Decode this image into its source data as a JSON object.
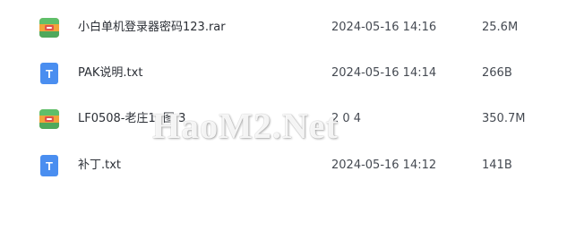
{
  "files": [
    {
      "name": "小白单机登录器密码123.rar",
      "date": "2024-05-16 14:16",
      "size": "25.6M",
      "icon": "archive-icon"
    },
    {
      "name": "PAK说明.txt",
      "date": "2024-05-16 14:14",
      "size": "266B",
      "icon": "text-file-icon",
      "icon_letter": "T"
    },
    {
      "name": "LF0508-老庄1.    图    3",
      "date": "2    0        4",
      "size": "350.7M",
      "icon": "archive-icon"
    },
    {
      "name": "补丁.txt",
      "date": "2024-05-16 14:12",
      "size": "141B",
      "icon": "text-file-icon",
      "icon_letter": "T"
    }
  ],
  "watermark": {
    "text": "HaoM2.Net"
  },
  "colors": {
    "text_file_icon": "#4a8ef0",
    "archive_orange": "#f2a33a",
    "archive_green": "#5fbf6a",
    "archive_red": "#e0534a"
  }
}
